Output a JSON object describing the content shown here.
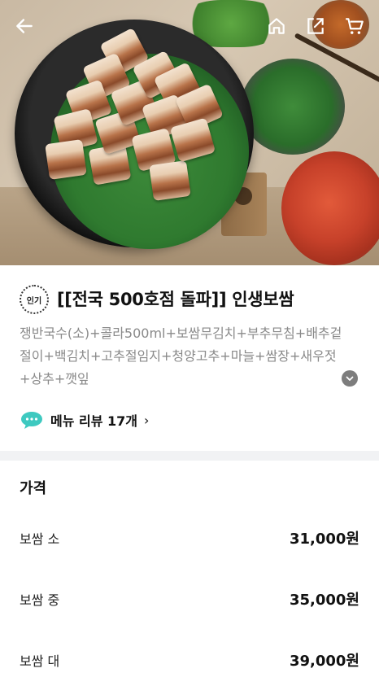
{
  "hero": {
    "image_alt": "보쌈 음식 사진"
  },
  "nav": {
    "back_icon": "arrow-left-icon",
    "home_icon": "home-icon",
    "share_icon": "share-icon",
    "cart_icon": "cart-icon"
  },
  "menu": {
    "badge": "인기",
    "title": "[[전국 500호점 돌파]] 인생보쌈",
    "description": "쟁반국수(소)+콜라500ml+보쌈무김치+부추무침+배추겉절이+백김치+고추절임지+청양고추+마늘+쌈장+새우젓+상추+깻잎",
    "review_label": "메뉴 리뷰 17개",
    "review_chevron": "›"
  },
  "price": {
    "heading": "가격",
    "options": [
      {
        "name": "보쌈 소",
        "amount": "31,000원"
      },
      {
        "name": "보쌈 중",
        "amount": "35,000원"
      },
      {
        "name": "보쌈 대",
        "amount": "39,000원"
      }
    ]
  },
  "colors": {
    "divider": "#f1f2f4",
    "review_bubble": "#3ec9c0"
  }
}
